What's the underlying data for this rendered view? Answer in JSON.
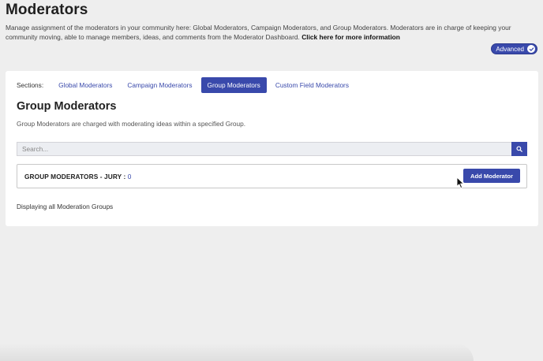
{
  "page": {
    "title": "Moderators",
    "description": "Manage assignment of the moderators in your community here: Global Moderators, Campaign Moderators, and Group Moderators. Moderators are in charge of keeping your community moving, able to manage members, ideas, and comments from the Moderator Dashboard. ",
    "info_link": "Click here for more information",
    "advanced_label": "Advanced"
  },
  "sections": {
    "label": "Sections:",
    "tabs": [
      {
        "label": "Global Moderators"
      },
      {
        "label": "Campaign Moderators"
      },
      {
        "label": "Group Moderators"
      },
      {
        "label": "Custom Field Moderators"
      }
    ],
    "active": "Group Moderators"
  },
  "group": {
    "title": "Group Moderators",
    "description": "Group Moderators are charged with moderating ideas within a specified Group.",
    "search_placeholder": "Search...",
    "box_label": "GROUP MODERATORS - JURY : ",
    "box_count": "0",
    "add_button": "Add Moderator",
    "displaying": "Displaying all Moderation Groups"
  },
  "colors": {
    "accent": "#3949ab",
    "background": "#eeeeee"
  }
}
